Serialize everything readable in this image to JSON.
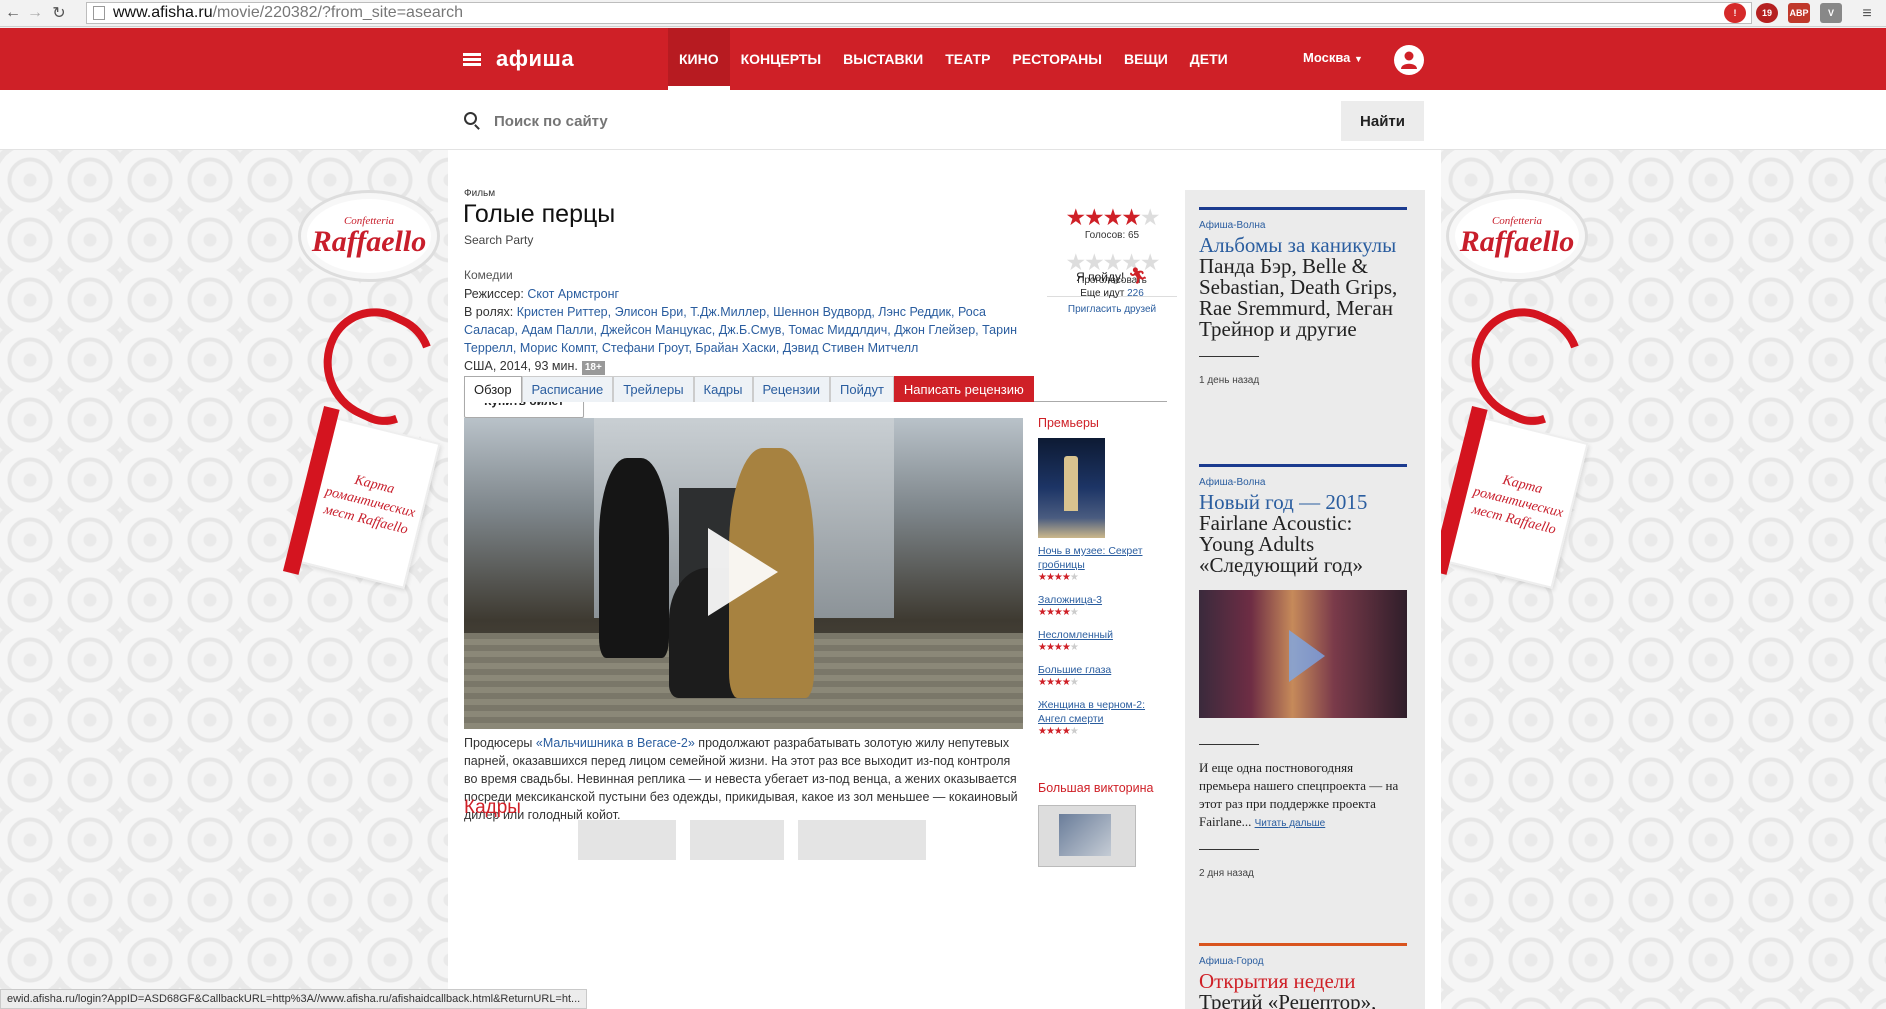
{
  "browser": {
    "url_host": "www.afisha.ru",
    "url_path": "/movie/220382/?from_site=asearch",
    "ext_badge_1": "19",
    "ext_badge_2": "ABP",
    "ext_badge_3": "19"
  },
  "header": {
    "logo": "афиша",
    "nav": [
      "КИНО",
      "КОНЦЕРТЫ",
      "ВЫСТАВКИ",
      "ТЕАТР",
      "РЕСТОРАНЫ",
      "ВЕЩИ",
      "ДЕТИ"
    ],
    "active_nav": "КИНО",
    "city": "Москва"
  },
  "search": {
    "placeholder": "Поиск по сайту",
    "button": "Найти"
  },
  "ad": {
    "brand_small": "Confetteria",
    "brand": "Raffaello",
    "card_text": "Карта романтических мест Raffaello"
  },
  "movie": {
    "kind": "Фильм",
    "title": "Голые перцы",
    "original_title": "Search Party",
    "genre": "Комедии",
    "director_label": "Режиссер:",
    "director": "Скот Армстронг",
    "cast_label": "В ролях:",
    "cast": "Кристен Риттер, Элисон Бри, Т.Дж.Миллер, Шеннон Вудворд, Лэнс Реддик, Роса Саласар, Адам Палли, Джейсон Манцукас, Дж.Б.Смув, Томас Миддлдич, Джон Глейзер, Тарин Террелл, Морис Компт, Стефани Гроут, Брайан Хаски, Дэвид Стивен Митчелл",
    "meta": "США, 2014, 93 мин.",
    "age": "18+",
    "buy_button": "Купить билет",
    "synopsis_prefix": "Продюсеры ",
    "synopsis_link": "«Мальчишника в Вегасе-2»",
    "synopsis_rest": " продолжают разрабатывать золотую жилу непутевых парней, оказавшихся перед лицом семейной жизни. На этот раз все выходит из-под контроля во время свадьбы. Невинная реплика — и невеста убегает из-под венца, а жених оказывается посреди мексиканской пустыни без одежды, прикидывая, какое из зол меньшее — кокаиновый дилер или голодный койот."
  },
  "rating": {
    "stars": 4,
    "max": 5,
    "votes_label": "Голосов: 65",
    "vote_label": "Проголосовать",
    "go_label": "Я пойду!",
    "going_prefix": "Еще идут",
    "going_count": "226",
    "invite": "Пригласить друзей"
  },
  "tabs": [
    "Обзор",
    "Расписание",
    "Трейлеры",
    "Кадры",
    "Рецензии",
    "Пойдут"
  ],
  "write_review": "Написать рецензию",
  "section_kadry": "Кадры",
  "premieres": {
    "heading": "Премьеры",
    "items": [
      {
        "title": "Ночь в музее: Секрет гробницы",
        "stars": 4
      },
      {
        "title": "Заложница-3",
        "stars": 4
      },
      {
        "title": "Несломленный",
        "stars": 4
      },
      {
        "title": "Большие глаза",
        "stars": 4
      },
      {
        "title": "Женщина в черном-2: Ангел смерти",
        "stars": 4
      }
    ],
    "quiz_heading": "Большая викторина"
  },
  "sidebar": {
    "item1": {
      "source": "Афиша-Волна",
      "headline_link": "Альбомы за каникулы",
      "headline_rest": " Панда Бэр, Belle & Sebastian, Death Grips, Rae Sremmurd, Меган Трейнор и другие",
      "date": "1 день назад"
    },
    "item2": {
      "source": "Афиша-Волна",
      "headline_link": "Новый год — 2015",
      "headline_rest": " Fairlane Acoustic: Young Adults «Следующий год»",
      "text": "И еще одна постновогодняя премьера нашего спецпроекта — на этот раз при поддержке проекта Fairlane... ",
      "read_more": "Читать дальше",
      "date": "2 дня назад"
    },
    "item3": {
      "source": "Афиша-Город",
      "headline_link": "Открытия недели",
      "headline_rest": " Третий «Рецептор»,"
    }
  },
  "status_bar": "ewid.afisha.ru/login?AppID=ASD68GF&CallbackURL=http%3A//www.afisha.ru/afishaidcallback.html&ReturnURL=ht..."
}
